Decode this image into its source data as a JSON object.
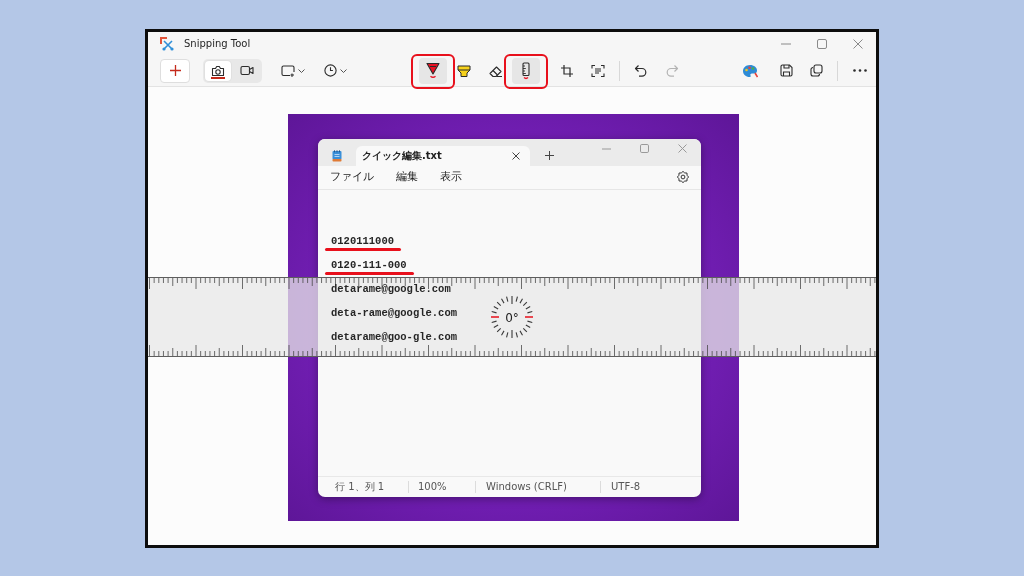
{
  "window": {
    "title": "Snipping Tool"
  },
  "toolbar": {
    "capture_modes": [
      {
        "kind": "photo",
        "selected": true
      },
      {
        "kind": "video",
        "selected": false
      }
    ],
    "tools": [
      {
        "kind": "pen",
        "selected": true,
        "highlighted": true
      },
      {
        "kind": "highlighter",
        "selected": false,
        "highlighted": false
      },
      {
        "kind": "eraser",
        "selected": false,
        "highlighted": false
      },
      {
        "kind": "ruler",
        "selected": true,
        "highlighted": true
      },
      {
        "kind": "crop",
        "selected": false,
        "highlighted": false
      },
      {
        "kind": "text-actions",
        "selected": false,
        "highlighted": false
      }
    ],
    "history": [
      {
        "kind": "undo",
        "disabled": false
      },
      {
        "kind": "redo",
        "disabled": true
      }
    ]
  },
  "notepad": {
    "tab": {
      "title": "クイック編集.txt"
    },
    "menu": [
      "ファイル",
      "編集",
      "表示"
    ],
    "lines": [
      {
        "text": "0120111000",
        "underlined": true
      },
      {
        "text": "0120-111-000",
        "underlined": true
      },
      {
        "text": "detarame@google.com",
        "underlined": false
      },
      {
        "text": "deta-rame@google.com",
        "underlined": false
      },
      {
        "text": "detarame@goo-gle.com",
        "underlined": false
      }
    ],
    "status_bar": [
      "行 1、列 1",
      "100%",
      "Windows (CRLF)",
      "UTF-8"
    ]
  },
  "ruler": {
    "angle": "0°"
  }
}
